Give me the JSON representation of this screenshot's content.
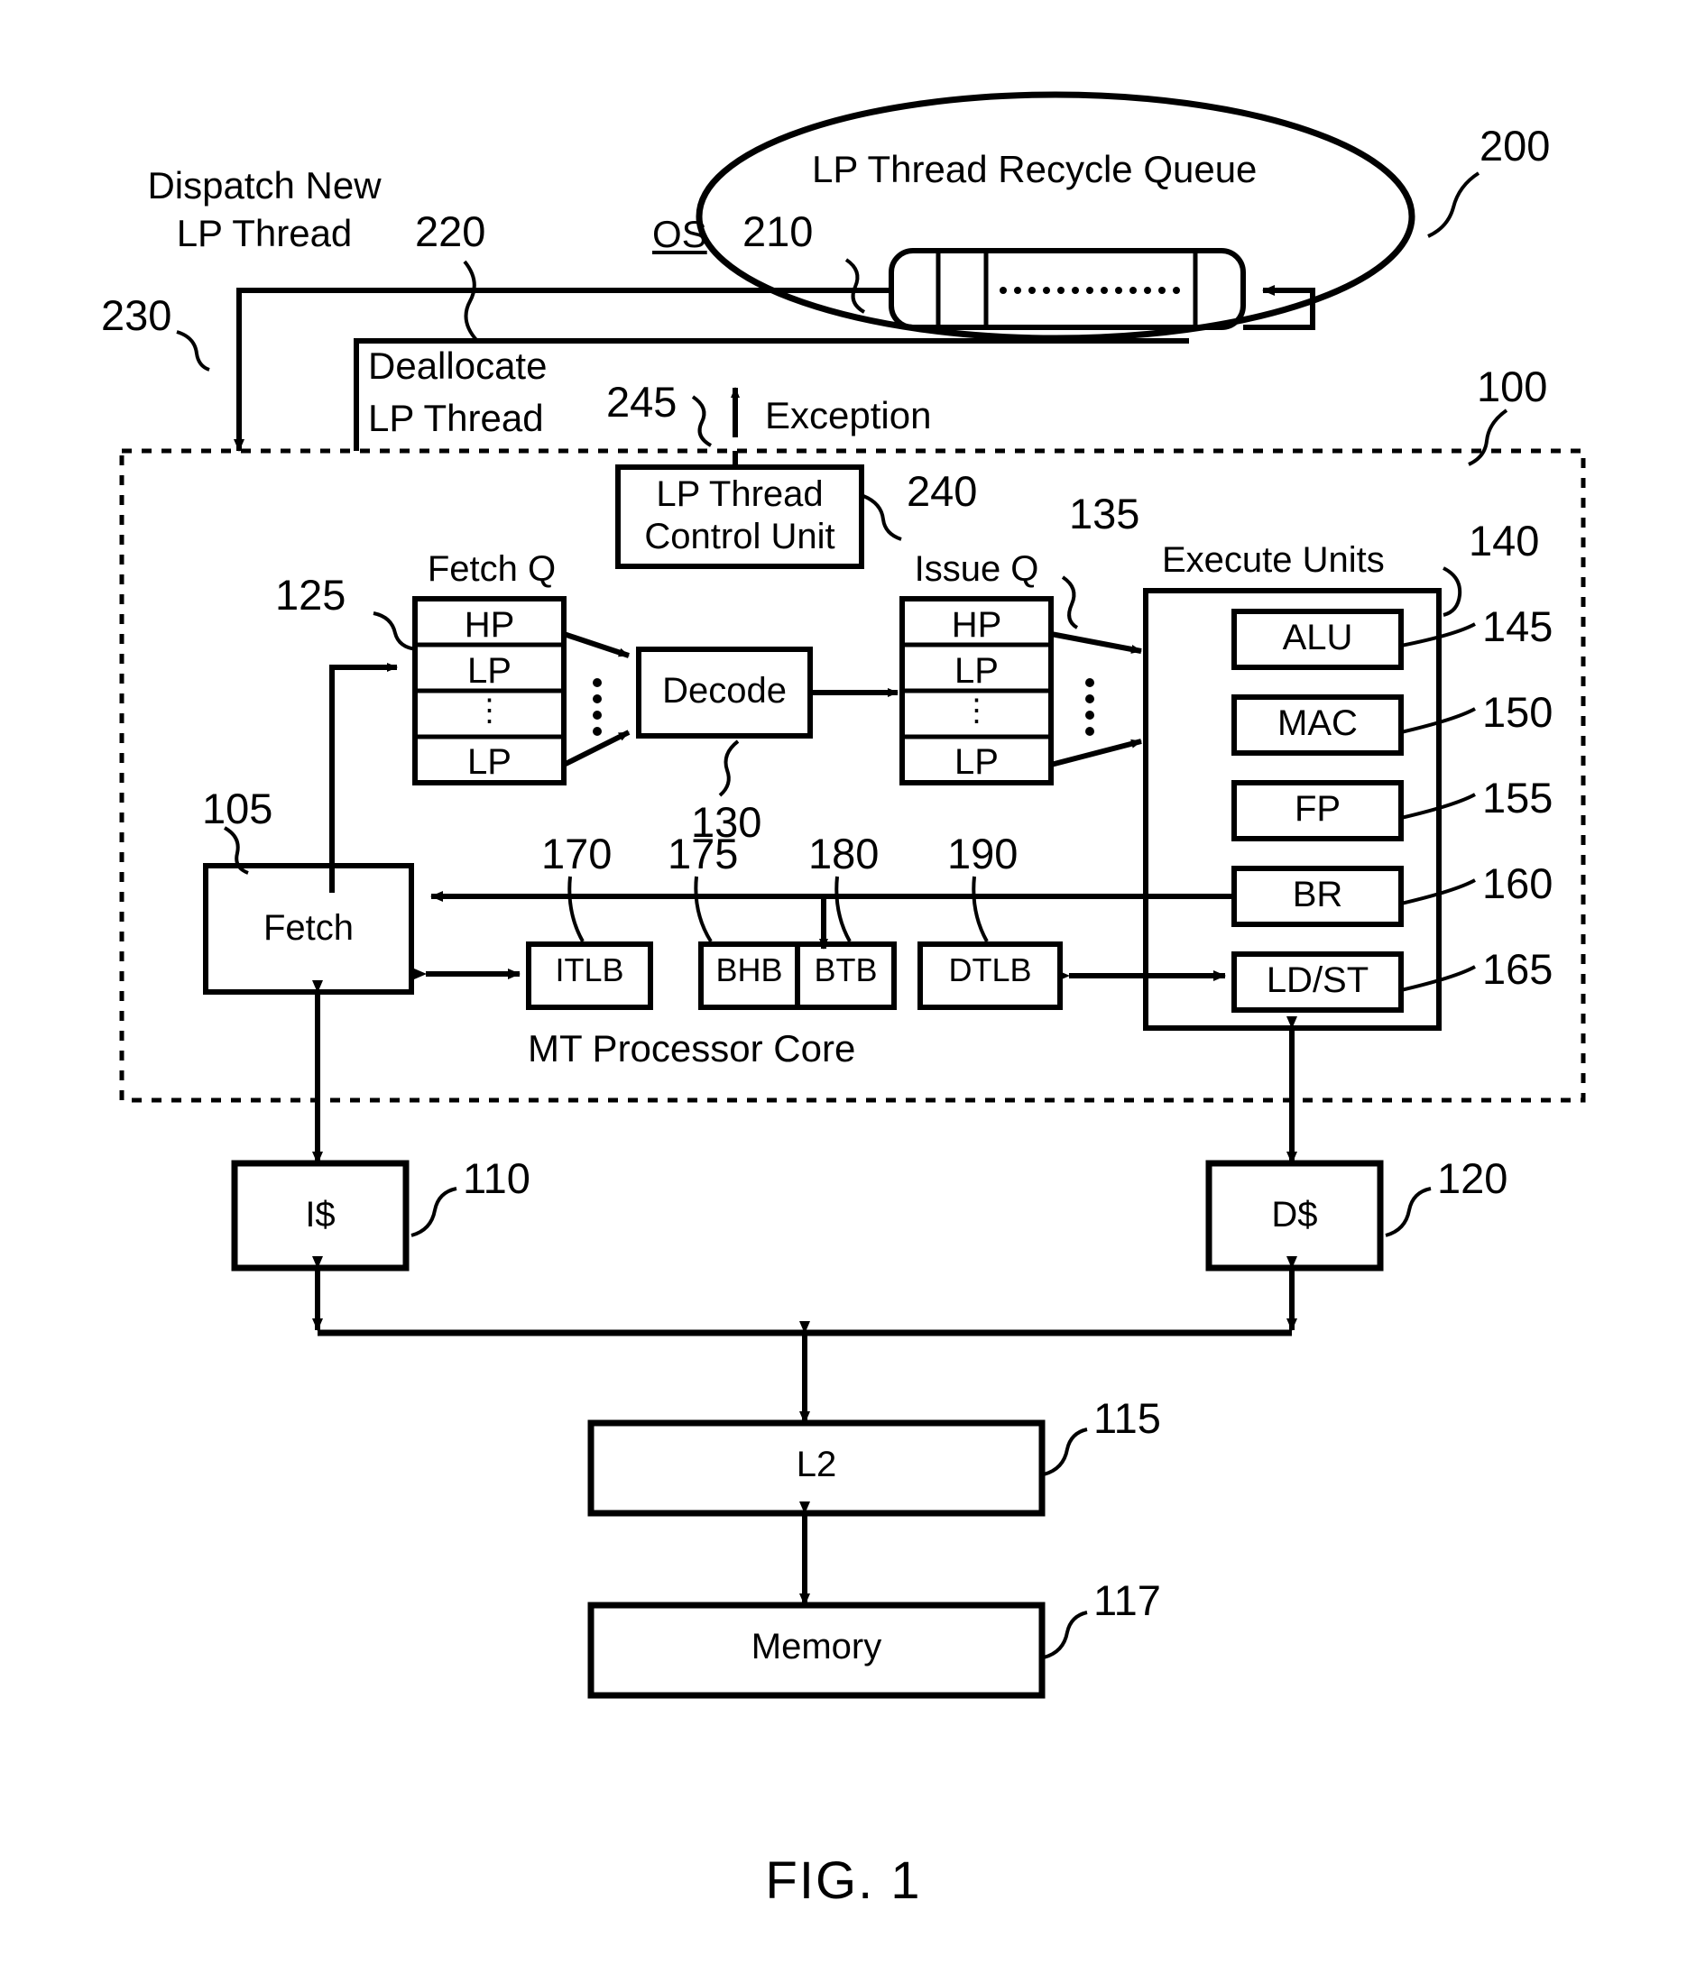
{
  "figure": {
    "caption": "FIG. 1"
  },
  "os_region": {
    "label": "OS",
    "ref": "210",
    "title": "LP Thread Recycle Queue",
    "ellipse_ref": "200",
    "queue_dots": "·················"
  },
  "flow_labels": {
    "dispatch_line1": "Dispatch New",
    "dispatch_line2": "LP Thread",
    "dispatch_ref": "220",
    "dispatch_ref2": "230",
    "deallocate_line1": "Deallocate",
    "deallocate_line2": "LP Thread",
    "exception_ref": "245",
    "exception_label": "Exception"
  },
  "core": {
    "ref": "100",
    "title": "MT Processor Core",
    "control_unit": {
      "line1": "LP Thread",
      "line2": "Control Unit",
      "ref": "240"
    },
    "fetch_queue": {
      "caption": "Fetch Q",
      "ref": "125",
      "cells": [
        "HP",
        "LP",
        "⋮",
        "LP"
      ],
      "dots": "⋮"
    },
    "decode": {
      "label": "Decode",
      "ref": "130"
    },
    "issue_queue": {
      "caption": "Issue Q",
      "ref": "135",
      "cells": [
        "HP",
        "LP",
        "⋮",
        "LP"
      ],
      "dots": "⋮"
    },
    "execute_units": {
      "caption": "Execute Units",
      "ref": "140",
      "units": [
        {
          "label": "ALU",
          "ref": "145"
        },
        {
          "label": "MAC",
          "ref": "150"
        },
        {
          "label": "FP",
          "ref": "155"
        },
        {
          "label": "BR",
          "ref": "160"
        },
        {
          "label": "LD/ST",
          "ref": "165"
        }
      ]
    },
    "fetch": {
      "label": "Fetch",
      "ref": "105"
    },
    "buffers": [
      {
        "label": "ITLB",
        "ref": "170"
      },
      {
        "label": "BHB",
        "ref": "175"
      },
      {
        "label": "BTB",
        "ref": "180"
      },
      {
        "label": "DTLB",
        "ref": "190"
      }
    ]
  },
  "memory_hierarchy": [
    {
      "label": "I$",
      "ref": "110"
    },
    {
      "label": "D$",
      "ref": "120"
    },
    {
      "label": "L2",
      "ref": "115"
    },
    {
      "label": "Memory",
      "ref": "117"
    }
  ],
  "colors": {
    "ink": "#000000",
    "paper": "#ffffff"
  }
}
